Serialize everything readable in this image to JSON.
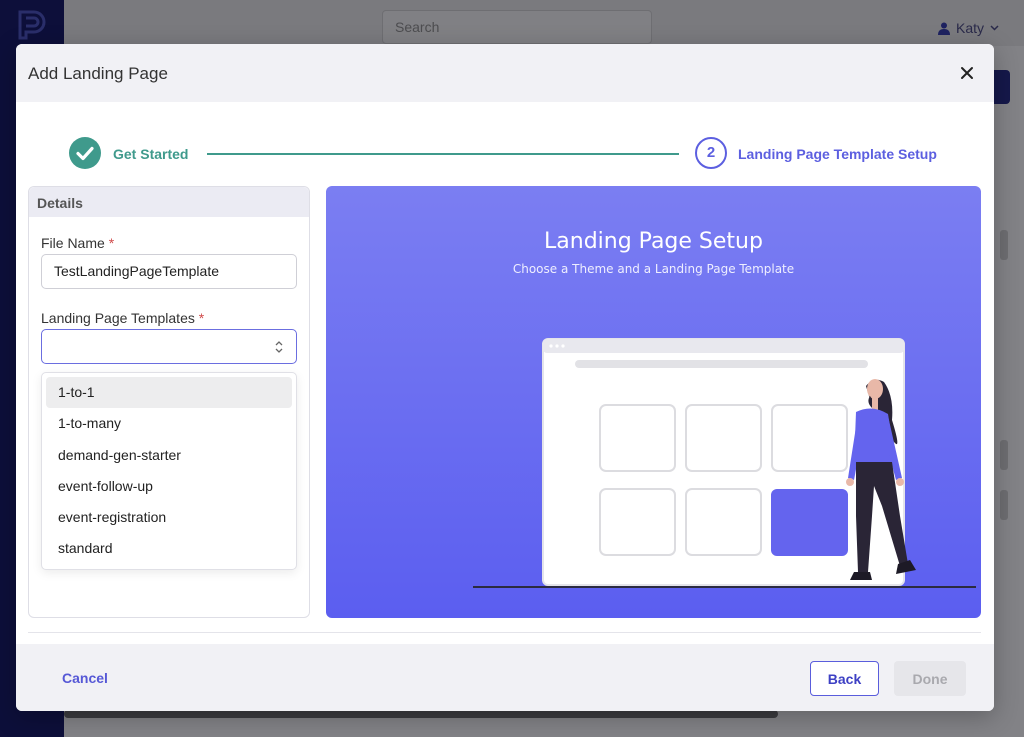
{
  "background_app": {
    "search_placeholder": "Search",
    "user_name": "Katy"
  },
  "modal": {
    "title": "Add Landing Page",
    "stepper": {
      "step1_label": "Get Started",
      "step2_number": "2",
      "step2_label": "Landing Page Template Setup",
      "completed_color": "#3f9a8c",
      "active_color": "#5c5fe0"
    },
    "details": {
      "header": "Details",
      "file_name_label": "File Name",
      "file_name_value": "TestLandingPageTemplate",
      "templates_label": "Landing Page Templates",
      "required_mark": "*",
      "template_options": [
        "1-to-1",
        "1-to-many",
        "demand-gen-starter",
        "event-follow-up",
        "event-registration",
        "standard"
      ]
    },
    "illustration": {
      "title": "Landing Page Setup",
      "subtitle": "Choose a Theme and a Landing Page Template"
    },
    "footer": {
      "cancel_label": "Cancel",
      "back_label": "Back",
      "done_label": "Done"
    }
  }
}
